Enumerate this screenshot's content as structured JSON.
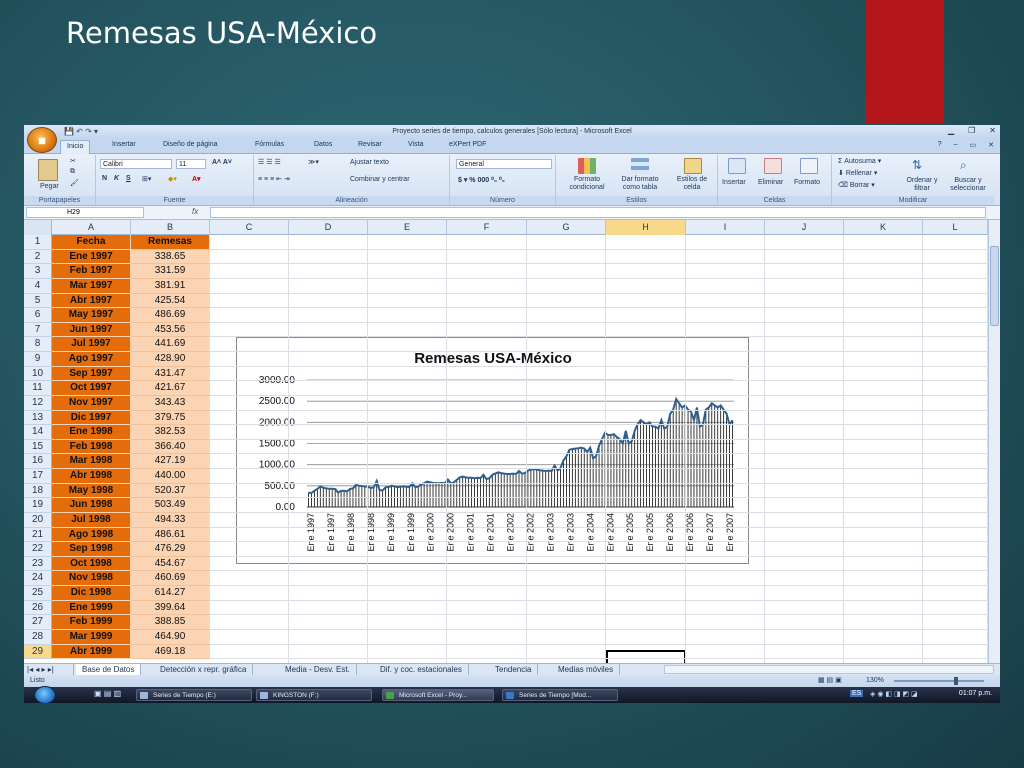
{
  "slide": {
    "title": "Remesas USA-México"
  },
  "window": {
    "title": "Proyecto series de tiempo, calculos generales [Sólo lectura] - Microsoft Excel",
    "office_button": "Office",
    "qat": "💾 ↶ ↷ ▾"
  },
  "tabs": [
    "Inicio",
    "Insertar",
    "Diseño de página",
    "Fórmulas",
    "Datos",
    "Revisar",
    "Vista",
    "eXPert PDF"
  ],
  "ribbon": {
    "paste": "Pegar",
    "font_name": "Calibri",
    "font_size": "11",
    "wrap_text": "Ajustar texto",
    "merge_center": "Combinar y centrar",
    "number_format": "General",
    "cond_format": "Formato condicional",
    "format_table": "Dar formato como tabla",
    "cell_styles": "Estilos de celda",
    "insert": "Insertar",
    "delete": "Eliminar",
    "format": "Formato",
    "autosum": "Autosuma",
    "fill": "Rellenar",
    "clear": "Borrar",
    "sort_filter": "Ordenar y filtrar",
    "find_select": "Buscar y seleccionar",
    "groups": [
      "Portapapeles",
      "Fuente",
      "Alineación",
      "Número",
      "Estilos",
      "Celdas",
      "Modificar"
    ]
  },
  "formula_bar": {
    "name_box": "H29",
    "fx": "fx"
  },
  "columns": [
    "A",
    "B",
    "C",
    "D",
    "E",
    "F",
    "G",
    "H",
    "I",
    "J",
    "K",
    "L"
  ],
  "table": {
    "headers": [
      "Fecha",
      "Remesas"
    ],
    "rows": [
      [
        "Ene 1997",
        "338.65"
      ],
      [
        "Feb 1997",
        "331.59"
      ],
      [
        "Mar 1997",
        "381.91"
      ],
      [
        "Abr 1997",
        "425.54"
      ],
      [
        "May 1997",
        "486.69"
      ],
      [
        "Jun 1997",
        "453.56"
      ],
      [
        "Jul 1997",
        "441.69"
      ],
      [
        "Ago 1997",
        "428.90"
      ],
      [
        "Sep 1997",
        "431.47"
      ],
      [
        "Oct 1997",
        "421.67"
      ],
      [
        "Nov 1997",
        "343.43"
      ],
      [
        "Dic 1997",
        "379.75"
      ],
      [
        "Ene 1998",
        "382.53"
      ],
      [
        "Feb 1998",
        "366.40"
      ],
      [
        "Mar 1998",
        "427.19"
      ],
      [
        "Abr 1998",
        "440.00"
      ],
      [
        "May 1998",
        "520.37"
      ],
      [
        "Jun 1998",
        "503.49"
      ],
      [
        "Jul 1998",
        "494.33"
      ],
      [
        "Ago 1998",
        "486.61"
      ],
      [
        "Sep 1998",
        "476.29"
      ],
      [
        "Oct 1998",
        "454.67"
      ],
      [
        "Nov 1998",
        "460.69"
      ],
      [
        "Dic 1998",
        "614.27"
      ],
      [
        "Ene 1999",
        "399.64"
      ],
      [
        "Feb 1999",
        "388.85"
      ],
      [
        "Mar 1999",
        "464.90"
      ],
      [
        "Abr 1999",
        "469.18"
      ]
    ]
  },
  "chart_data": {
    "type": "line",
    "title": "Remesas USA-México",
    "ylim": [
      0,
      3000
    ],
    "yticks": [
      "0.00",
      "500.00",
      "1000.00",
      "1500.00",
      "2000.00",
      "2500.00",
      "3000.00"
    ],
    "xtick_labels": [
      "Ene 1997",
      "Ene 1997",
      "Ene 1998",
      "Ene 1998",
      "Ene 1999",
      "Ene 1999",
      "Ene 2000",
      "Ene 2000",
      "Ene 2001",
      "Ene 2001",
      "Ene 2002",
      "Ene 2002",
      "Ene 2003",
      "Ene 2003",
      "Ene 2004",
      "Ene 2004",
      "Ene 2005",
      "Ene 2005",
      "Ene 2006",
      "Ene 2006",
      "Ene 2007",
      "Ene 2007"
    ],
    "grid": true,
    "x_start": "Ene 1997",
    "x_end": "Dic 2007",
    "values": [
      338.65,
      331.59,
      381.91,
      425.54,
      486.69,
      453.56,
      441.69,
      428.9,
      431.47,
      421.67,
      343.43,
      379.75,
      382.53,
      366.4,
      427.19,
      440.0,
      520.37,
      503.49,
      494.33,
      486.61,
      476.29,
      454.67,
      460.69,
      614.27,
      399.64,
      388.85,
      464.9,
      469.18,
      500,
      490,
      470,
      480,
      490,
      480,
      470,
      560,
      470,
      480,
      540,
      560,
      600,
      580,
      570,
      560,
      560,
      570,
      560,
      650,
      560,
      580,
      640,
      700,
      720,
      700,
      690,
      690,
      680,
      690,
      680,
      760,
      660,
      680,
      760,
      790,
      820,
      800,
      790,
      780,
      780,
      790,
      780,
      850,
      790,
      800,
      860,
      880,
      900,
      880,
      870,
      860,
      850,
      860,
      850,
      980,
      860,
      920,
      1100,
      1200,
      1350,
      1370,
      1380,
      1390,
      1400,
      1380,
      1300,
      1400,
      1150,
      1200,
      1450,
      1600,
      1750,
      1700,
      1700,
      1720,
      1650,
      1600,
      1500,
      1800,
      1500,
      1550,
      1800,
      1950,
      2050,
      2000,
      1950,
      2000,
      1900,
      1900,
      1850,
      2050,
      1850,
      1900,
      2200,
      2300,
      2550,
      2450,
      2350,
      2400,
      2300,
      2250,
      2050,
      2350,
      1900,
      1950,
      2300,
      2350,
      2450,
      2400,
      2350,
      2400,
      2300,
      2200,
      1950,
      2050
    ]
  },
  "sheet_tabs": [
    "Base de Datos",
    "Detección x repr. gráfica",
    "Media - Desv. Est.",
    "Dif. y coc. estacionales",
    "Tendencia",
    "Medias móviles"
  ],
  "status": {
    "ready": "Listo",
    "zoom": "130%"
  },
  "taskbar": {
    "items": [
      "Series de Tiempo (E:)",
      "KINGSTON (F:)",
      "Microsoft Excel - Proy...",
      "Series de Tiempo [Mod..."
    ],
    "lang": "ES",
    "clock": "01:07 p.m."
  }
}
